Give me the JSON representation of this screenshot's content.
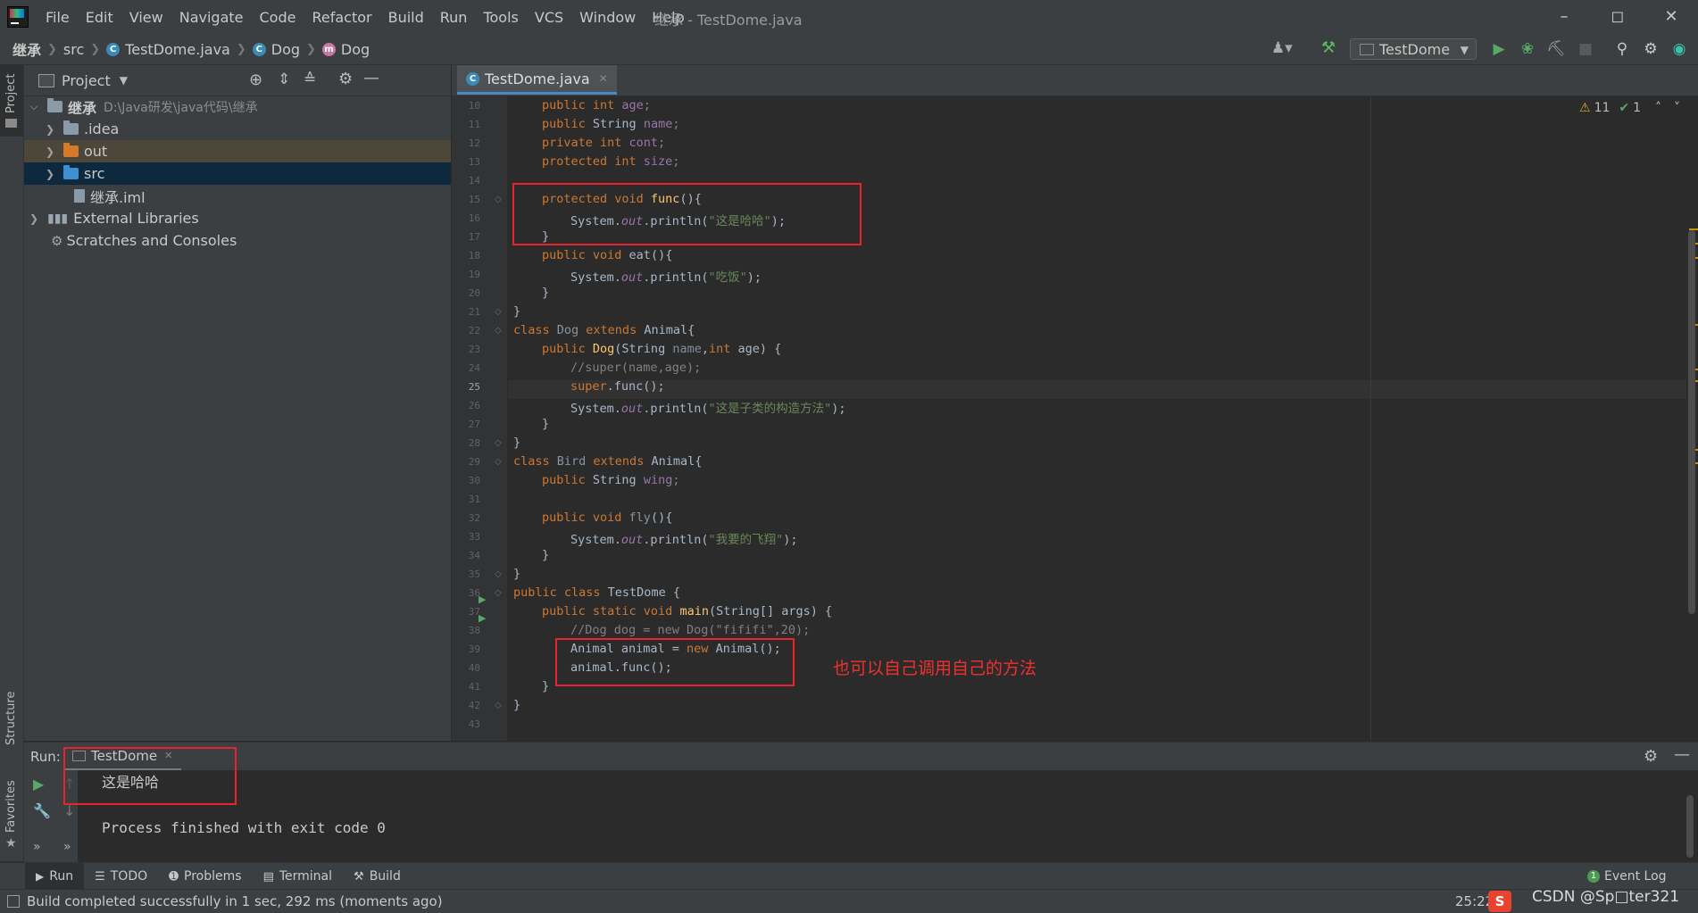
{
  "window": {
    "menu": [
      "File",
      "Edit",
      "View",
      "Navigate",
      "Code",
      "Refactor",
      "Build",
      "Run",
      "Tools",
      "VCS",
      "Window",
      "Help"
    ],
    "title": "继承 - TestDome.java"
  },
  "navbar": {
    "breadcrumb": [
      "继承",
      "src",
      "TestDome.java",
      "Dog",
      "Dog"
    ],
    "run_config": "TestDome"
  },
  "left_strip": {
    "project": "Project",
    "structure": "Structure",
    "favorites": "Favorites"
  },
  "project_panel": {
    "title": "Project",
    "tree": [
      {
        "label": "继承",
        "path": "D:\\Java研发\\java代码\\继承"
      },
      {
        "label": ".idea"
      },
      {
        "label": "out"
      },
      {
        "label": "src"
      },
      {
        "label": "继承.iml"
      },
      {
        "label": "External Libraries"
      },
      {
        "label": "Scratches and Consoles"
      }
    ]
  },
  "editor": {
    "tab": "TestDome.java",
    "inspections": {
      "warnings": "11",
      "ok": "1"
    },
    "lines": [
      {
        "n": "10"
      },
      {
        "n": "11"
      },
      {
        "n": "12"
      },
      {
        "n": "13"
      },
      {
        "n": "14"
      },
      {
        "n": "15"
      },
      {
        "n": "16"
      },
      {
        "n": "17"
      },
      {
        "n": "18"
      },
      {
        "n": "19"
      },
      {
        "n": "20"
      },
      {
        "n": "21"
      },
      {
        "n": "22"
      },
      {
        "n": "23"
      },
      {
        "n": "24"
      },
      {
        "n": "25"
      },
      {
        "n": "26"
      },
      {
        "n": "27"
      },
      {
        "n": "28"
      },
      {
        "n": "29"
      },
      {
        "n": "30"
      },
      {
        "n": "31"
      },
      {
        "n": "32"
      },
      {
        "n": "33"
      },
      {
        "n": "34"
      },
      {
        "n": "35"
      },
      {
        "n": "36"
      },
      {
        "n": "37"
      },
      {
        "n": "38"
      },
      {
        "n": "39"
      },
      {
        "n": "40"
      },
      {
        "n": "41"
      },
      {
        "n": "42"
      },
      {
        "n": "43"
      }
    ],
    "code": {
      "l10": [
        "public int ",
        "age;"
      ],
      "l11": [
        "public ",
        "String ",
        "name;"
      ],
      "l12": [
        "private int ",
        "cont;"
      ],
      "l13": [
        "protected int ",
        "size;"
      ],
      "l15": [
        "protected void ",
        "func",
        "(){"
      ],
      "l16": [
        "System.",
        "out",
        ".println(",
        "\"这是哈哈\"",
        ");"
      ],
      "l17": "}",
      "l18": [
        "public void ",
        "eat",
        "(){"
      ],
      "l19": [
        "System.",
        "out",
        ".println(",
        "\"吃饭\"",
        ");"
      ],
      "l20": "}",
      "l21": "}",
      "l22": [
        "class ",
        "Dog ",
        "extends ",
        "Animal{"
      ],
      "l23": [
        "public ",
        "Dog",
        "(String ",
        "name",
        ",",
        "int ",
        "age) {"
      ],
      "l24": "//super(name,age);",
      "l25": [
        "super",
        ".func();"
      ],
      "l26": [
        "System.",
        "out",
        ".println(",
        "\"这是子类的构造方法\"",
        ");"
      ],
      "l27": "}",
      "l28": "}",
      "l29": [
        "class ",
        "Bird ",
        "extends ",
        "Animal{"
      ],
      "l30": [
        "public ",
        "String ",
        "wing;"
      ],
      "l32": [
        "public void ",
        "fly",
        "(){"
      ],
      "l33": [
        "System.",
        "out",
        ".println(",
        "\"我要的飞翔\"",
        ");"
      ],
      "l34": "}",
      "l35": "}",
      "l36": [
        "public class ",
        "TestDome {"
      ],
      "l37": [
        "public static void ",
        "main",
        "(String[] args) {"
      ],
      "l38": "//Dog dog = new Dog(\"fififi\",20);",
      "l39": [
        "Animal animal = ",
        "new ",
        "Animal();"
      ],
      "l40": "animal.func();",
      "l41": "}",
      "l42": "}"
    },
    "annotation": "也可以自己调用自己的方法"
  },
  "run_panel": {
    "label": "Run:",
    "tab": "TestDome",
    "output": [
      "这是哈哈",
      "",
      "Process finished with exit code 0"
    ]
  },
  "tool_windows": [
    "Run",
    "TODO",
    "Problems",
    "Terminal",
    "Build"
  ],
  "event_log": {
    "label": "Event Log",
    "count": "1"
  },
  "status": {
    "message": "Build completed successfully in 1 sec, 292 ms (moments ago)",
    "position": "25:22",
    "watermark": "CSDN @Sp□ter321"
  },
  "colors": {
    "accent": "#4a88c7",
    "annotation": "#f0302f",
    "keyword": "#cc7832",
    "string": "#6a8759"
  }
}
